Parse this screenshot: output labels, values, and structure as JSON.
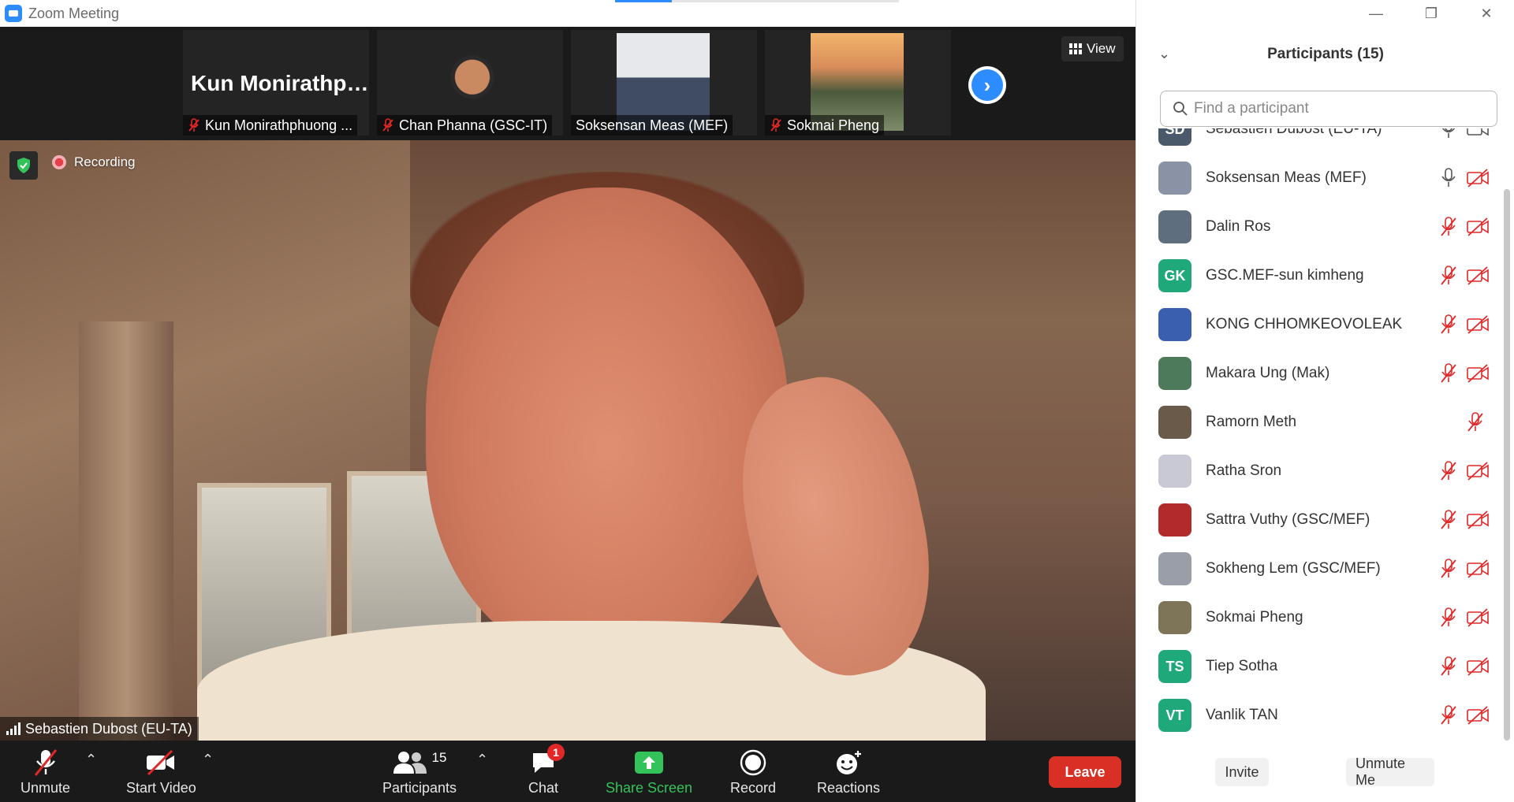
{
  "window": {
    "title": "Zoom Meeting",
    "controls": [
      "minimize",
      "restore",
      "close"
    ]
  },
  "strip": {
    "thumbs": [
      {
        "big_name": "Kun  Monirathp…",
        "label": "Kun Monirathphuong ...",
        "muted": true
      },
      {
        "label": "Chan Phanna (GSC-IT)",
        "muted": true
      },
      {
        "label": "Soksensan Meas (MEF)",
        "muted": false
      },
      {
        "label": "Sokmai Pheng",
        "muted": true
      }
    ],
    "view_label": "View",
    "next_icon": "chevron-right-icon"
  },
  "main": {
    "recording_label": "Recording",
    "speaker": "Sebastien Dubost (EU-TA)"
  },
  "toolbar": {
    "unmute": "Unmute",
    "start_video": "Start Video",
    "participants_count": "15",
    "participants": "Participants",
    "chat": "Chat",
    "chat_badge": "1",
    "share_screen": "Share Screen",
    "record": "Record",
    "reactions": "Reactions",
    "leave": "Leave"
  },
  "panel": {
    "title": "Participants (15)",
    "search_placeholder": "Find a participant",
    "participants": [
      {
        "initials": "SD",
        "name": "Sebastien Dubost (EU-TA)",
        "avatar_color": "#4a5a6a",
        "mic": "on",
        "cam": "on"
      },
      {
        "initials": "",
        "name": "Soksensan Meas (MEF)",
        "avatar_color": "#8a93a6",
        "mic": "on",
        "cam": "off"
      },
      {
        "initials": "",
        "name": "Dalin Ros",
        "avatar_color": "#5e6e7e",
        "mic": "off",
        "cam": "off"
      },
      {
        "initials": "GK",
        "name": "GSC.MEF-sun kimheng",
        "avatar_color": "#1fa97a",
        "mic": "off",
        "cam": "off"
      },
      {
        "initials": "",
        "name": "KONG CHHOMKEOVOLEAK",
        "avatar_color": "#3a5fae",
        "mic": "off",
        "cam": "off"
      },
      {
        "initials": "",
        "name": "Makara Ung (Mak)",
        "avatar_color": "#4d7a5a",
        "mic": "off",
        "cam": "off"
      },
      {
        "initials": "",
        "name": "Ramorn Meth",
        "avatar_color": "#6a5a4a",
        "mic": "off",
        "cam": "none"
      },
      {
        "initials": "",
        "name": "Ratha Sron",
        "avatar_color": "#c9c9d6",
        "mic": "off",
        "cam": "off"
      },
      {
        "initials": "",
        "name": "Sattra Vuthy (GSC/MEF)",
        "avatar_color": "#b22a2a",
        "mic": "off",
        "cam": "off"
      },
      {
        "initials": "",
        "name": "Sokheng Lem (GSC/MEF)",
        "avatar_color": "#9a9ea8",
        "mic": "off",
        "cam": "off"
      },
      {
        "initials": "",
        "name": "Sokmai Pheng",
        "avatar_color": "#7e7458",
        "mic": "off",
        "cam": "off"
      },
      {
        "initials": "TS",
        "name": "Tiep Sotha",
        "avatar_color": "#1fa97a",
        "mic": "off",
        "cam": "off"
      },
      {
        "initials": "VT",
        "name": "Vanlik TAN",
        "avatar_color": "#1fa97a",
        "mic": "off",
        "cam": "off"
      }
    ],
    "invite": "Invite",
    "unmute_me": "Unmute Me"
  },
  "colors": {
    "accent": "#2d8cff",
    "leave": "#d93025",
    "muted_red": "#e02828",
    "share_green": "#34c25a",
    "avatar_green": "#1fa97a"
  }
}
